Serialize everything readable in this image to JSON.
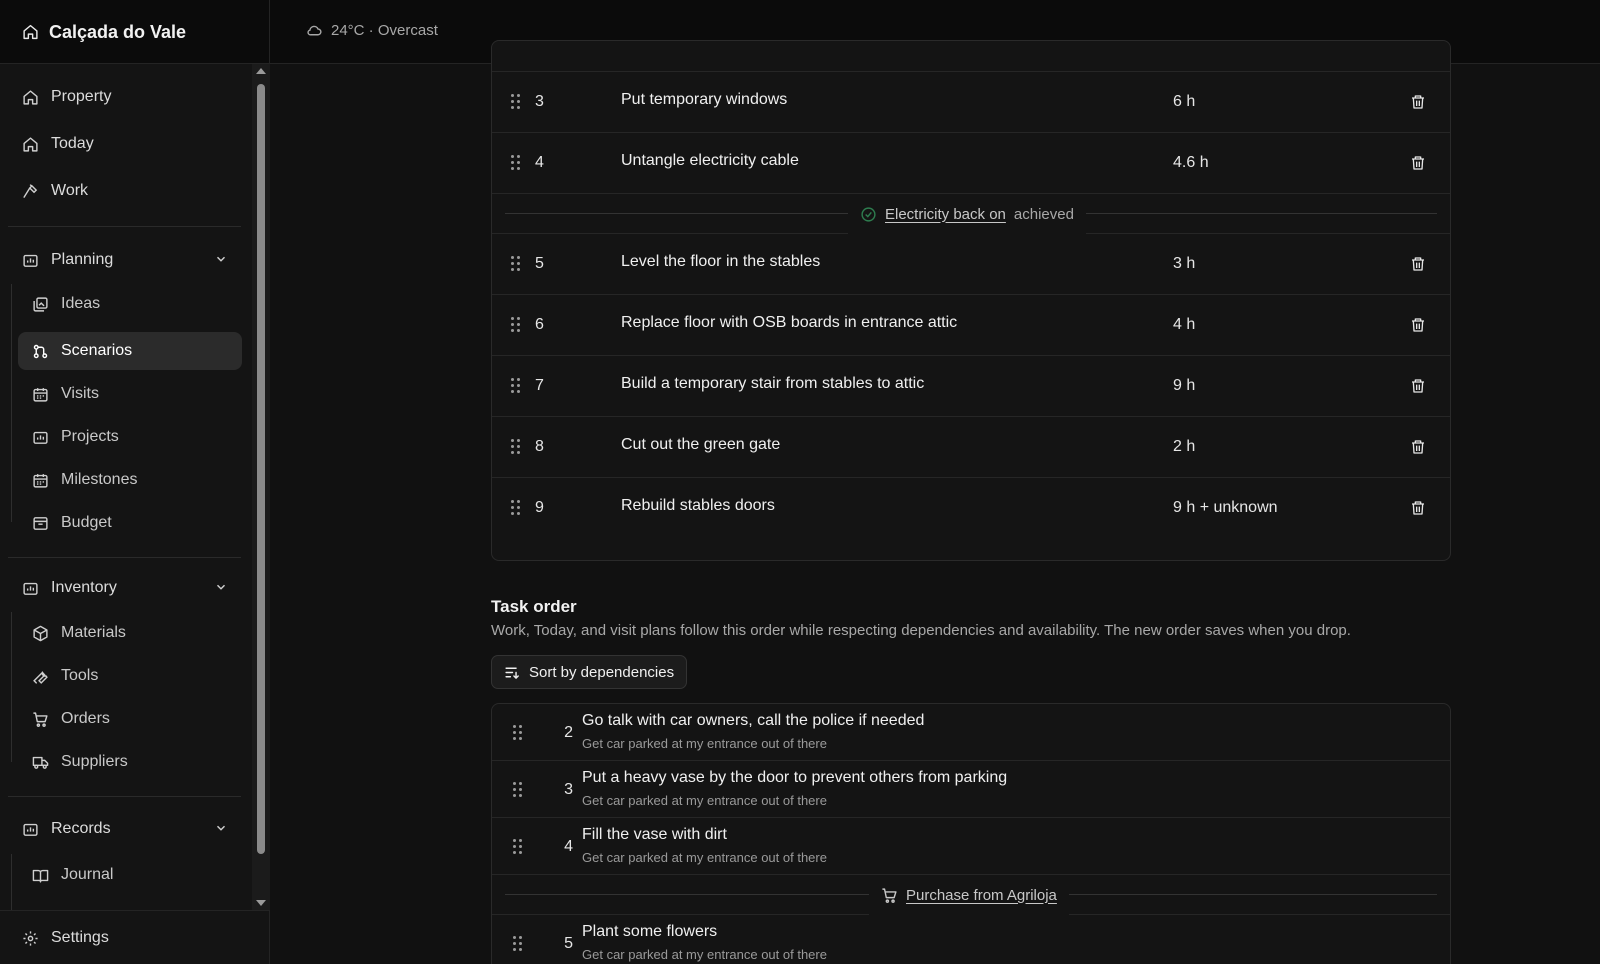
{
  "app": {
    "title": "Calçada do Vale"
  },
  "weather": {
    "text": "24°C · Overcast",
    "icon": "cloud-icon"
  },
  "sidebar": {
    "top_items": [
      {
        "label": "Property",
        "icon": "home-icon"
      },
      {
        "label": "Today",
        "icon": "home-icon"
      },
      {
        "label": "Work",
        "icon": "hammer-icon"
      }
    ],
    "planning": {
      "label": "Planning",
      "items": [
        {
          "label": "Ideas",
          "icon": "gallery-icon"
        },
        {
          "label": "Scenarios",
          "icon": "git-branch-icon",
          "active": true
        },
        {
          "label": "Visits",
          "icon": "calendar-icon"
        },
        {
          "label": "Projects",
          "icon": "chart-folder-icon"
        },
        {
          "label": "Milestones",
          "icon": "calendar-icon"
        },
        {
          "label": "Budget",
          "icon": "archive-icon"
        }
      ]
    },
    "inventory": {
      "label": "Inventory",
      "items": [
        {
          "label": "Materials",
          "icon": "package-icon"
        },
        {
          "label": "Tools",
          "icon": "wrench-icon"
        },
        {
          "label": "Orders",
          "icon": "cart-icon"
        },
        {
          "label": "Suppliers",
          "icon": "truck-icon"
        }
      ]
    },
    "records": {
      "label": "Records",
      "items": [
        {
          "label": "Journal",
          "icon": "book-icon"
        }
      ]
    },
    "settings": {
      "label": "Settings",
      "icon": "gear-icon"
    }
  },
  "tasks": [
    {
      "num": "3",
      "name": "Put temporary windows",
      "hours": "6 h"
    },
    {
      "num": "4",
      "name": "Untangle electricity cable",
      "hours": "4.6 h"
    },
    {
      "num": "5",
      "name": "Level the floor in the stables",
      "hours": "3 h"
    },
    {
      "num": "6",
      "name": "Replace floor with OSB boards in entrance attic",
      "hours": "4 h"
    },
    {
      "num": "7",
      "name": "Build a temporary stair from stables to attic",
      "hours": "9 h"
    },
    {
      "num": "8",
      "name": "Cut out the green gate",
      "hours": "2 h"
    },
    {
      "num": "9",
      "name": "Rebuild stables doors",
      "hours": "9 h + unknown"
    }
  ],
  "milestone": {
    "link": "Electricity back on",
    "suffix": "achieved"
  },
  "task_order": {
    "title": "Task order",
    "description": "Work, Today, and visit plans follow this order while respecting dependencies and availability. The new order saves when you drop.",
    "sort_button": "Sort by dependencies",
    "items": [
      {
        "num": "2",
        "title": "Go talk with car owners, call the police if needed",
        "sub": "Get car parked at my entrance out of there"
      },
      {
        "num": "3",
        "title": "Put a heavy vase by the door to prevent others from parking",
        "sub": "Get car parked at my entrance out of there"
      },
      {
        "num": "4",
        "title": "Fill the vase with dirt",
        "sub": "Get car parked at my entrance out of there"
      },
      {
        "num": "5",
        "title": "Plant some flowers",
        "sub": "Get car parked at my entrance out of there"
      }
    ],
    "purchase_link": "Purchase from Agriloja"
  },
  "colors": {
    "background": "#111111",
    "panel": "#141414",
    "border": "#2a2a2a",
    "milestone_check": "#2e7d4f"
  }
}
